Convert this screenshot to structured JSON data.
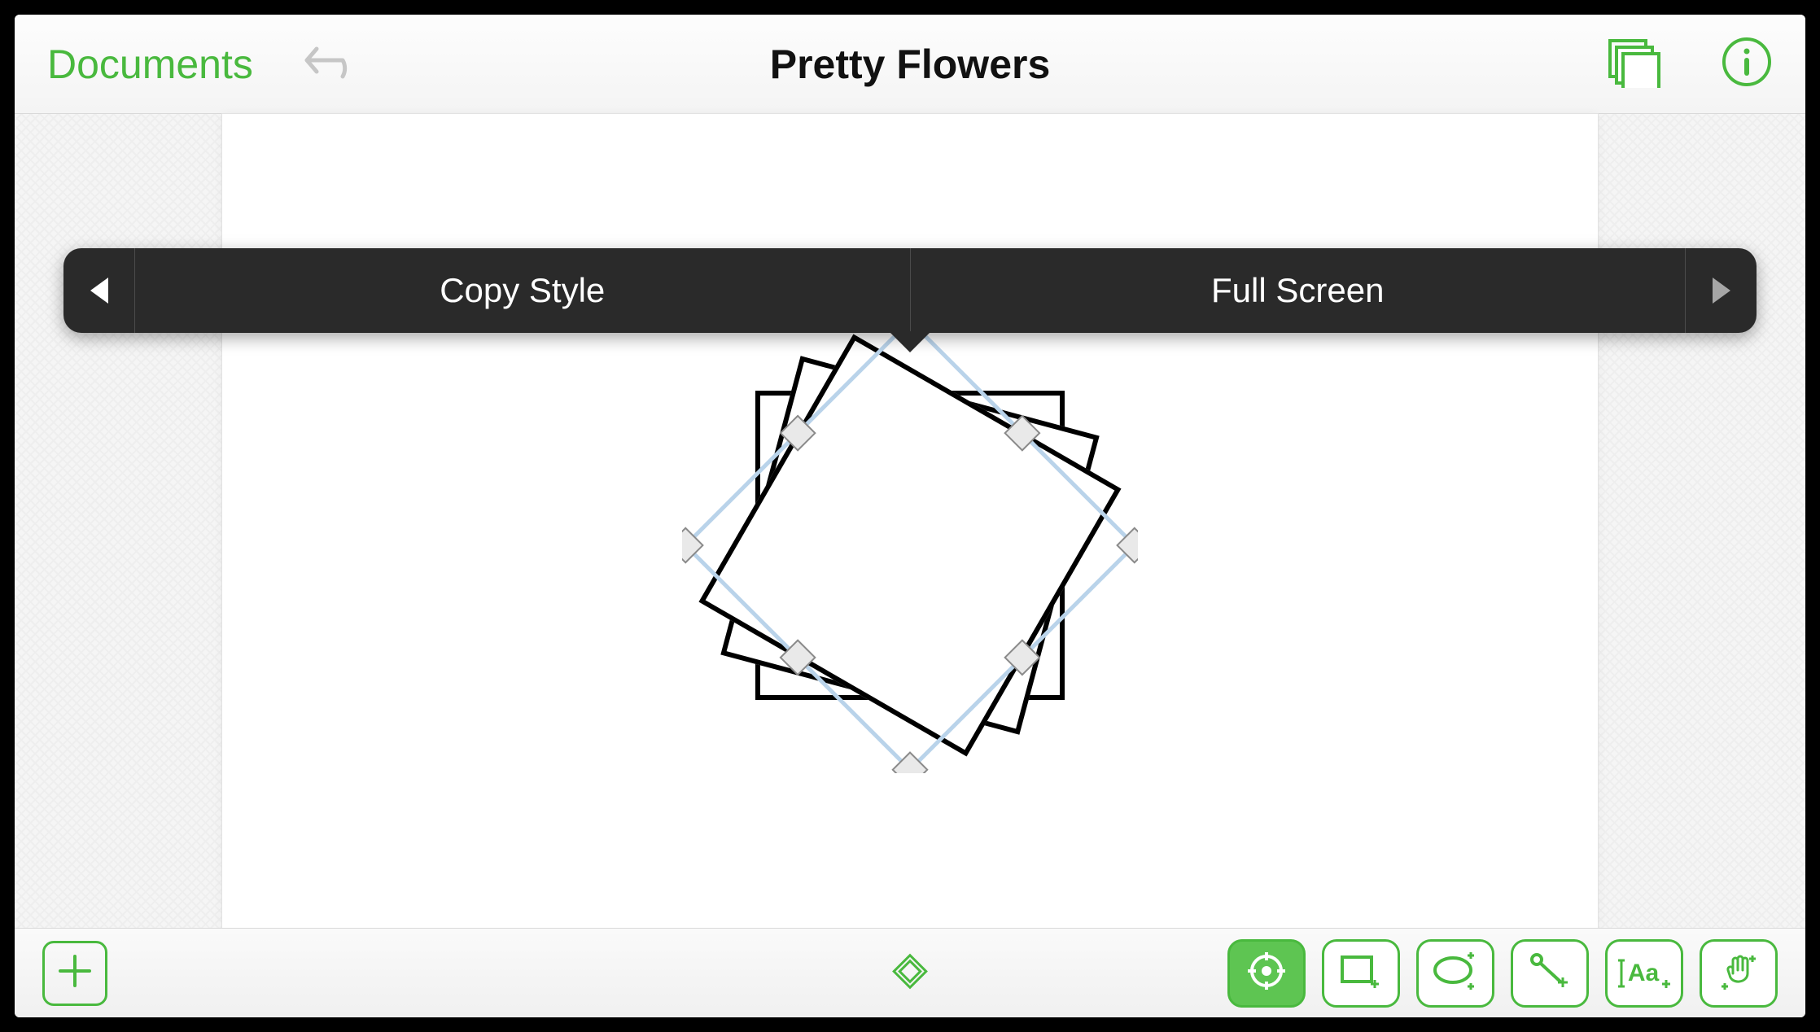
{
  "header": {
    "documents_label": "Documents",
    "title": "Pretty Flowers"
  },
  "popover": {
    "copy_style_label": "Copy Style",
    "full_screen_label": "Full Screen"
  },
  "colors": {
    "accent": "#49b93e"
  },
  "icons": {
    "undo": "undo-icon",
    "stencils": "stencils-icon",
    "info": "info-icon",
    "add": "add-icon",
    "diamond_indicator": "diamond-indicator-icon",
    "selection": "selection-tool-icon",
    "rectangle": "rectangle-tool-icon",
    "ellipse": "ellipse-tool-icon",
    "line": "line-tool-icon",
    "text": "text-tool-icon",
    "hand": "hand-tool-icon"
  },
  "toolbar_labels": {
    "text_tool_glyph": "Aa"
  }
}
